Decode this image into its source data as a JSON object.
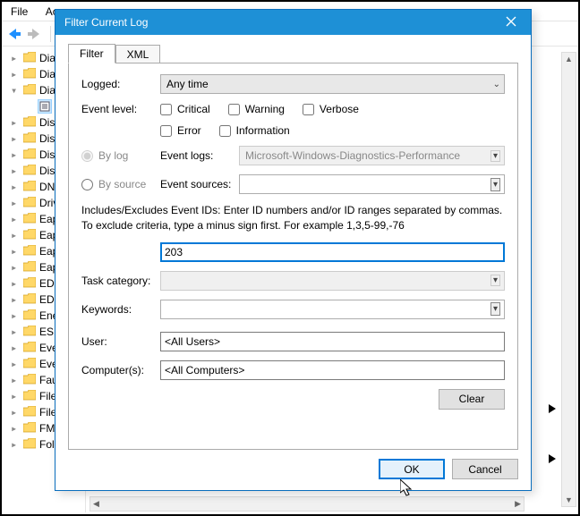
{
  "bg": {
    "menu": {
      "file": "File",
      "action": "Ac"
    },
    "tree": {
      "items": [
        {
          "label": "Dia",
          "type": "folder",
          "kind": ">"
        },
        {
          "label": "Dia",
          "type": "folder",
          "kind": ">"
        },
        {
          "label": "Dia",
          "type": "folder",
          "kind": "v"
        },
        {
          "label": "",
          "type": "log",
          "kind": " ",
          "selected": true
        },
        {
          "label": "Disk",
          "type": "folder",
          "kind": ">"
        },
        {
          "label": "Disk",
          "type": "folder",
          "kind": ">"
        },
        {
          "label": "Disk",
          "type": "folder",
          "kind": ">"
        },
        {
          "label": "Disp",
          "type": "folder",
          "kind": ">"
        },
        {
          "label": "DNS",
          "type": "folder",
          "kind": ">"
        },
        {
          "label": "Driv",
          "type": "folder",
          "kind": ">"
        },
        {
          "label": "Eap",
          "type": "folder",
          "kind": ">"
        },
        {
          "label": "Eap",
          "type": "folder",
          "kind": ">"
        },
        {
          "label": "Eap",
          "type": "folder",
          "kind": ">"
        },
        {
          "label": "Eap",
          "type": "folder",
          "kind": ">"
        },
        {
          "label": "EDP",
          "type": "folder",
          "kind": ">"
        },
        {
          "label": "EDP",
          "type": "folder",
          "kind": ">"
        },
        {
          "label": "Ene",
          "type": "folder",
          "kind": ">"
        },
        {
          "label": "ESE",
          "type": "folder",
          "kind": ">"
        },
        {
          "label": "Eve",
          "type": "folder",
          "kind": ">"
        },
        {
          "label": "Eve",
          "type": "folder",
          "kind": ">"
        },
        {
          "label": "Fau",
          "type": "folder",
          "kind": ">"
        },
        {
          "label": "File",
          "type": "folder",
          "kind": ">"
        },
        {
          "label": "File",
          "type": "folder",
          "kind": ">"
        },
        {
          "label": "FMS",
          "type": "folder",
          "kind": ">"
        },
        {
          "label": "Fol",
          "type": "folder",
          "kind": ">"
        }
      ]
    }
  },
  "dialog": {
    "title": "Filter Current Log",
    "tabs": {
      "filter": "Filter",
      "xml": "XML"
    },
    "logged_label": "Logged:",
    "logged_value": "Any time",
    "level_label": "Event level:",
    "level": {
      "critical": "Critical",
      "warning": "Warning",
      "verbose": "Verbose",
      "error": "Error",
      "information": "Information"
    },
    "by_log": "By log",
    "by_source": "By source",
    "event_logs_label": "Event logs:",
    "event_logs_value": "Microsoft-Windows-Diagnostics-Performance",
    "event_sources_label": "Event sources:",
    "event_sources_value": "",
    "instructions": "Includes/Excludes Event IDs: Enter ID numbers and/or ID ranges separated by commas. To exclude criteria, type a minus sign first. For example 1,3,5-99,-76",
    "event_id_value": "203",
    "task_label": "Task category:",
    "task_value": "",
    "keywords_label": "Keywords:",
    "keywords_value": "",
    "user_label": "User:",
    "user_value": "<All Users>",
    "computers_label": "Computer(s):",
    "computers_value": "<All Computers>",
    "clear": "Clear",
    "ok": "OK",
    "cancel": "Cancel"
  }
}
